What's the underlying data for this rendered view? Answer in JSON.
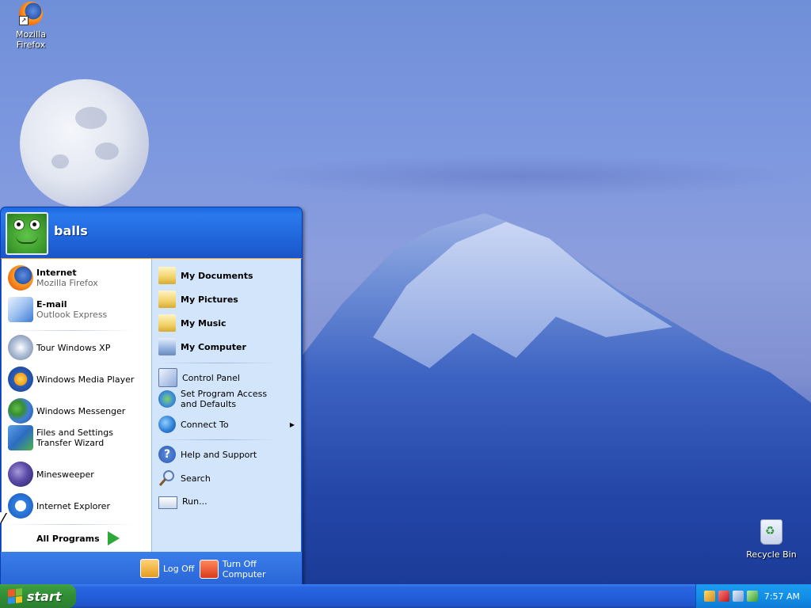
{
  "desktop": {
    "icons": [
      {
        "label": "Mozilla Firefox",
        "icon": "firefox-icon"
      },
      {
        "label": "Recycle Bin",
        "icon": "recycle-bin-icon"
      }
    ]
  },
  "start_menu": {
    "user": "balls",
    "pinned": [
      {
        "label": "Internet",
        "sub": "Mozilla Firefox",
        "icon": "firefox-icon"
      },
      {
        "label": "E-mail",
        "sub": "Outlook Express",
        "icon": "outlook-express-icon"
      }
    ],
    "recent": [
      {
        "label": "Tour Windows XP",
        "icon": "tour-xp-icon"
      },
      {
        "label": "Windows Media Player",
        "icon": "media-player-icon"
      },
      {
        "label": "Windows Messenger",
        "icon": "messenger-icon"
      },
      {
        "label": "Files and Settings Transfer Wizard",
        "icon": "transfer-wizard-icon"
      },
      {
        "label": "Minesweeper",
        "icon": "minesweeper-icon"
      },
      {
        "label": "Internet Explorer",
        "icon": "internet-explorer-icon"
      }
    ],
    "all_programs": "All Programs",
    "places": [
      {
        "label": "My Documents",
        "icon": "folder-icon"
      },
      {
        "label": "My Pictures",
        "icon": "folder-icon"
      },
      {
        "label": "My Music",
        "icon": "folder-icon"
      },
      {
        "label": "My Computer",
        "icon": "computer-icon"
      }
    ],
    "settings": [
      {
        "label": "Control Panel",
        "icon": "control-panel-icon"
      },
      {
        "label": "Set Program Access and Defaults",
        "icon": "program-access-icon"
      },
      {
        "label": "Connect To",
        "icon": "connect-icon"
      }
    ],
    "help": [
      {
        "label": "Help and Support",
        "icon": "help-icon"
      },
      {
        "label": "Search",
        "icon": "search-icon"
      },
      {
        "label": "Run...",
        "icon": "run-icon"
      }
    ],
    "log_off": "Log Off",
    "turn_off": "Turn Off Computer"
  },
  "taskbar": {
    "start_label": "start",
    "clock": "7:57 AM"
  },
  "colors": {
    "taskbar_blue": "#245edb",
    "start_green": "#2f8a33",
    "menu_right_bg": "#d3e5fa"
  }
}
